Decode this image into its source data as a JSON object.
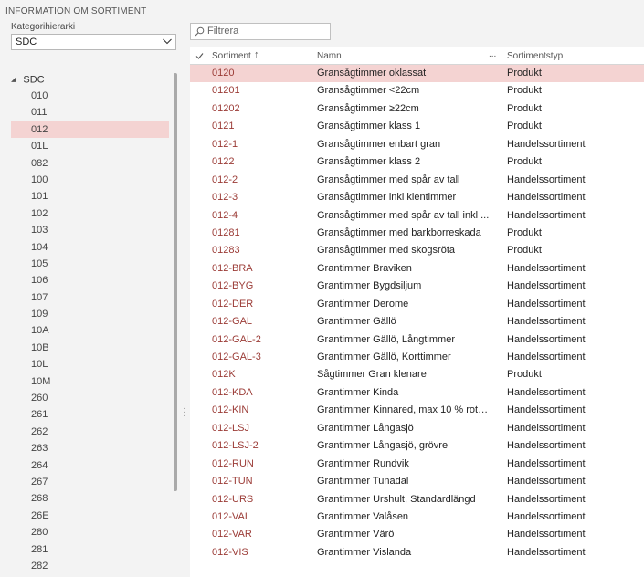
{
  "page": {
    "title": "INFORMATION OM SORTIMENT"
  },
  "hierarchy": {
    "label": "Kategorihierarki",
    "selected": "SDC"
  },
  "tree": {
    "root": "SDC",
    "items": [
      "010",
      "011",
      "012",
      "01L",
      "082",
      "100",
      "101",
      "102",
      "103",
      "104",
      "105",
      "106",
      "107",
      "109",
      "10A",
      "10B",
      "10L",
      "10M",
      "260",
      "261",
      "262",
      "263",
      "264",
      "267",
      "268",
      "26E",
      "280",
      "281",
      "282"
    ],
    "selected_index": 2
  },
  "filter": {
    "placeholder": "Filtrera"
  },
  "grid": {
    "columns": {
      "sortiment": "Sortiment",
      "sort_arrow": "↑",
      "namn": "Namn",
      "more": "...",
      "typ": "Sortimentstyp"
    },
    "selected_index": 0,
    "rows": [
      {
        "code": "0120",
        "name": "Gransågtimmer oklassat",
        "type": "Produkt"
      },
      {
        "code": "01201",
        "name": "Gransågtimmer <22cm",
        "type": "Produkt"
      },
      {
        "code": "01202",
        "name": "Gransågtimmer ≥22cm",
        "type": "Produkt"
      },
      {
        "code": "0121",
        "name": "Gransågtimmer klass 1",
        "type": "Produkt"
      },
      {
        "code": "012-1",
        "name": "Gransågtimmer enbart gran",
        "type": "Handelssortiment"
      },
      {
        "code": "0122",
        "name": "Gransågtimmer klass 2",
        "type": "Produkt"
      },
      {
        "code": "012-2",
        "name": "Gransågtimmer med spår av tall",
        "type": "Handelssortiment"
      },
      {
        "code": "012-3",
        "name": "Gransågtimmer inkl klentimmer",
        "type": "Handelssortiment"
      },
      {
        "code": "012-4",
        "name": "Gransågtimmer med spår av tall inkl ...",
        "type": "Handelssortiment"
      },
      {
        "code": "01281",
        "name": "Gransågtimmer med barkborreskada",
        "type": "Produkt"
      },
      {
        "code": "01283",
        "name": "Gransågtimmer med skogsröta",
        "type": "Produkt"
      },
      {
        "code": "012-BRA",
        "name": "Grantimmer Braviken",
        "type": "Handelssortiment"
      },
      {
        "code": "012-BYG",
        "name": "Grantimmer Bygdsiljum",
        "type": "Handelssortiment"
      },
      {
        "code": "012-DER",
        "name": "Grantimmer Derome",
        "type": "Handelssortiment"
      },
      {
        "code": "012-GAL",
        "name": "Grantimmer Gällö",
        "type": "Handelssortiment"
      },
      {
        "code": "012-GAL-2",
        "name": "Grantimmer Gällö, Långtimmer",
        "type": "Handelssortiment"
      },
      {
        "code": "012-GAL-3",
        "name": "Grantimmer Gällö, Korttimmer",
        "type": "Handelssortiment"
      },
      {
        "code": "012K",
        "name": "Sågtimmer Gran klenare",
        "type": "Produkt"
      },
      {
        "code": "012-KDA",
        "name": "Grantimmer Kinda",
        "type": "Handelssortiment"
      },
      {
        "code": "012-KIN",
        "name": "Grantimmer Kinnared, max 10 % rots...",
        "type": "Handelssortiment"
      },
      {
        "code": "012-LSJ",
        "name": "Grantimmer Långasjö",
        "type": "Handelssortiment"
      },
      {
        "code": "012-LSJ-2",
        "name": "Grantimmer Långasjö, grövre",
        "type": "Handelssortiment"
      },
      {
        "code": "012-RUN",
        "name": "Grantimmer Rundvik",
        "type": "Handelssortiment"
      },
      {
        "code": "012-TUN",
        "name": "Grantimmer Tunadal",
        "type": "Handelssortiment"
      },
      {
        "code": "012-URS",
        "name": "Grantimmer Urshult, Standardlängd",
        "type": "Handelssortiment"
      },
      {
        "code": "012-VAL",
        "name": "Grantimmer Valåsen",
        "type": "Handelssortiment"
      },
      {
        "code": "012-VAR",
        "name": "Grantimmer Värö",
        "type": "Handelssortiment"
      },
      {
        "code": "012-VIS",
        "name": "Grantimmer Vislanda",
        "type": "Handelssortiment"
      }
    ]
  }
}
